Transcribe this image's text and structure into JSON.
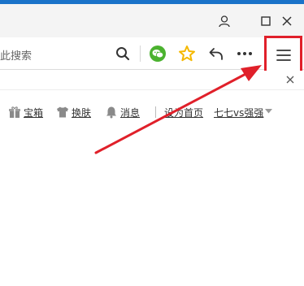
{
  "window": {
    "controls": {
      "account_icon": "person-icon",
      "maximize_icon": "square-icon",
      "close_icon": "x-icon"
    }
  },
  "toolbar": {
    "search_text": "此搜索",
    "icons": [
      "search-icon",
      "wechat-icon",
      "star-icon",
      "undo-icon",
      "more-icon",
      "menu-icon"
    ],
    "accent_colors": {
      "wechat": "#4bb22f",
      "star": "#f5b800",
      "highlight": "#e0202a"
    }
  },
  "links": {
    "treasure": "宝箱",
    "skin": "换肤",
    "messages": "消息",
    "set_homepage": "设为首页",
    "user": "七七vs强强"
  }
}
